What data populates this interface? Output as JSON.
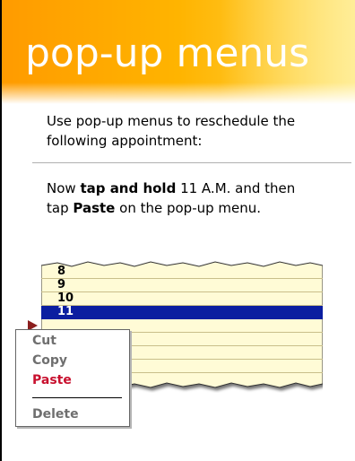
{
  "header": {
    "title": "pop-up menus"
  },
  "content": {
    "intro": "Use pop-up menus to reschedule the following appointment:",
    "instruction_parts": [
      {
        "text": "Now ",
        "bold": false
      },
      {
        "text": "tap and hold",
        "bold": true
      },
      {
        "text": " 11 A.M. and then tap ",
        "bold": false
      },
      {
        "text": "Paste",
        "bold": true
      },
      {
        "text": " on the pop-up menu.",
        "bold": false
      }
    ]
  },
  "calendar": {
    "hours": [
      "8",
      "9",
      "10",
      "11",
      "",
      "",
      "",
      ""
    ],
    "selected_hour": "11",
    "colors": {
      "paper": "#fffbd6",
      "line": "#c9bf8a",
      "selected": "#0b1ea0"
    }
  },
  "context_menu": {
    "items": [
      {
        "label": "Cut",
        "enabled": true,
        "active": false
      },
      {
        "label": "Copy",
        "enabled": true,
        "active": false
      },
      {
        "label": "Paste",
        "enabled": true,
        "active": true
      },
      {
        "label": "Delete",
        "enabled": true,
        "active": false
      }
    ]
  },
  "colors": {
    "banner_start": "#ff9b00",
    "banner_end": "#ffd64a",
    "accent": "#c8102e",
    "pointer": "#8b1e1e"
  },
  "icons": {
    "pointer": "pointer-arrow-icon"
  }
}
